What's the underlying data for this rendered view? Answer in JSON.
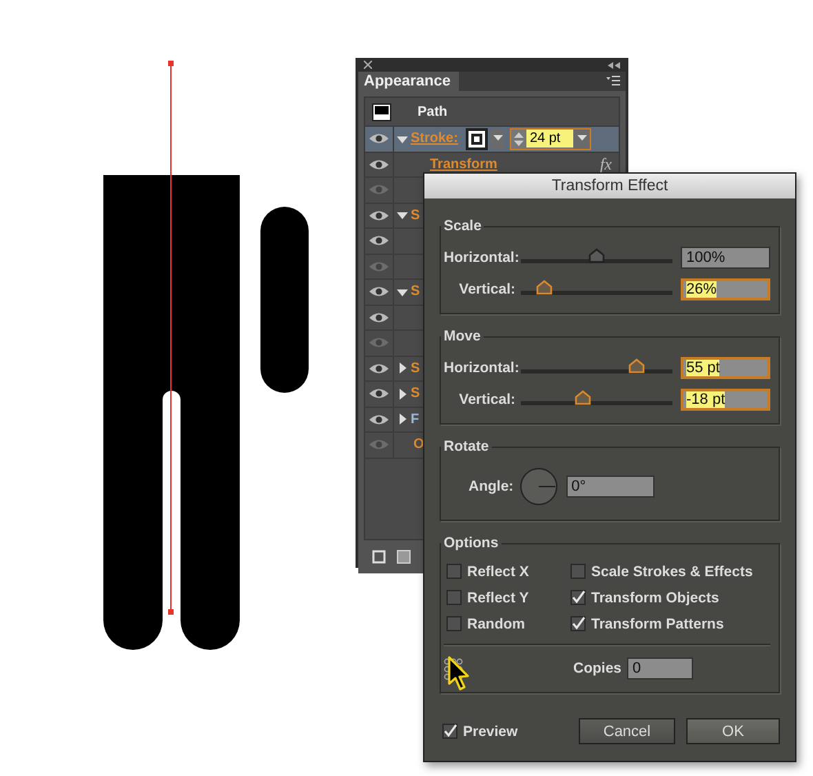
{
  "appearance_panel": {
    "title": "Appearance",
    "object_label": "Path",
    "rows": [
      {
        "kind": "stroke",
        "visible": true,
        "selected": true,
        "expanded": true,
        "label": "Stroke:",
        "color": "#e08a2e",
        "weight": "24 pt"
      },
      {
        "kind": "effect",
        "visible": true,
        "selected": false,
        "label": "Transform",
        "color": "#e08a2e",
        "badge": "fx"
      },
      {
        "kind": "blank",
        "visible": false,
        "selected": false
      },
      {
        "kind": "group",
        "visible": true,
        "selected": false,
        "expanded": true,
        "label": "S",
        "color": "#e08a2e"
      },
      {
        "kind": "blank",
        "visible": true,
        "selected": false
      },
      {
        "kind": "blank",
        "visible": false,
        "selected": false
      },
      {
        "kind": "group",
        "visible": true,
        "selected": false,
        "expanded": true,
        "label": "S",
        "color": "#e08a2e"
      },
      {
        "kind": "blank",
        "visible": true,
        "selected": false
      },
      {
        "kind": "blank",
        "visible": false,
        "selected": false
      },
      {
        "kind": "group",
        "visible": true,
        "selected": false,
        "expanded": false,
        "label": "S",
        "color": "#e08a2e"
      },
      {
        "kind": "group",
        "visible": true,
        "selected": false,
        "expanded": false,
        "label": "S",
        "color": "#e08a2e"
      },
      {
        "kind": "group",
        "visible": true,
        "selected": false,
        "expanded": false,
        "label": "F",
        "color": "#9fb7d8"
      },
      {
        "kind": "item",
        "visible": false,
        "selected": false,
        "label": "O",
        "color": "#e08a2e"
      }
    ]
  },
  "dialog": {
    "title": "Transform Effect",
    "sections": [
      {
        "title": "Scale",
        "sliders": [
          {
            "label": "Horizontal:",
            "level": 0.5,
            "value": "100%",
            "focused": false
          },
          {
            "label": "Vertical:",
            "level": 0.15,
            "value": "26%",
            "focused": true
          }
        ]
      },
      {
        "title": "Move",
        "sliders": [
          {
            "label": "Horizontal:",
            "level": 0.76,
            "value": "55 pt",
            "focused": true
          },
          {
            "label": "Vertical:",
            "level": 0.41,
            "value": "-18 pt",
            "focused": true
          }
        ]
      }
    ],
    "rotate": {
      "title": "Rotate",
      "label": "Angle:",
      "value": "0°"
    },
    "options": {
      "title": "Options",
      "checkboxes": [
        {
          "label": "Reflect X",
          "checked": false
        },
        {
          "label": "Reflect Y",
          "checked": false
        },
        {
          "label": "Random",
          "checked": false
        },
        {
          "label": "Scale Strokes & Effects",
          "checked": false
        },
        {
          "label": "Transform Objects",
          "checked": true
        },
        {
          "label": "Transform Patterns",
          "checked": true
        }
      ],
      "copies_label": "Copies",
      "copies": "0"
    },
    "preview": {
      "label": "Preview",
      "checked": true
    },
    "buttons": [
      {
        "label": "Cancel",
        "default": false
      },
      {
        "label": "OK",
        "default": true
      }
    ]
  }
}
